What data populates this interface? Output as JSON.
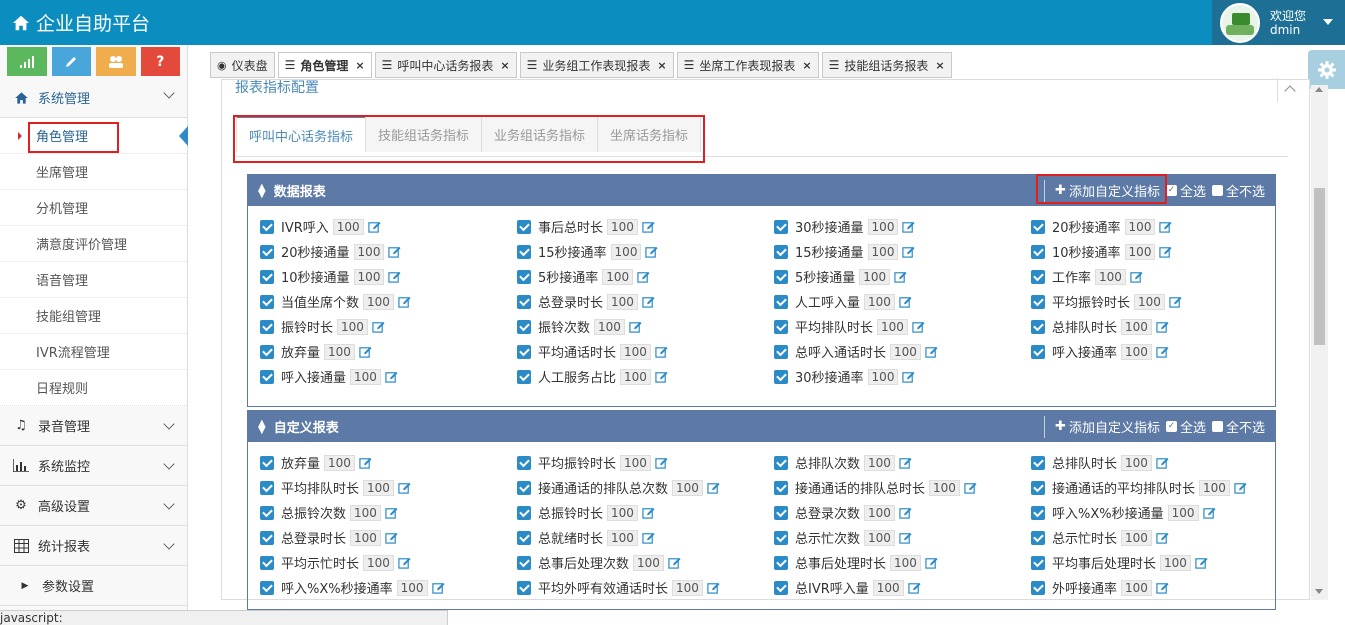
{
  "header": {
    "title": "企业自助平台",
    "welcome": "欢迎您",
    "username": "dmin"
  },
  "sidebar": {
    "groups": [
      {
        "label": "系统管理",
        "icon": "home-icon",
        "open": true,
        "items": [
          "角色管理",
          "坐席管理",
          "分机管理",
          "满意度评价管理",
          "语音管理",
          "技能组管理",
          "IVR流程管理",
          "日程规则"
        ]
      },
      {
        "label": "录音管理",
        "icon": "music-icon"
      },
      {
        "label": "系统监控",
        "icon": "bar-chart-icon"
      },
      {
        "label": "高级设置",
        "icon": "gears-icon"
      },
      {
        "label": "统计报表",
        "icon": "table-icon"
      },
      {
        "label": "参数设置",
        "icon": "caret-right-icon"
      }
    ]
  },
  "tabs": [
    {
      "label": "仪表盘",
      "icon": "dashboard-icon",
      "closable": false
    },
    {
      "label": "角色管理",
      "icon": "list-icon",
      "closable": true,
      "active": true
    },
    {
      "label": "呼叫中心话务报表",
      "icon": "list-icon",
      "closable": true
    },
    {
      "label": "业务组工作表现报表",
      "icon": "list-icon",
      "closable": true
    },
    {
      "label": "坐席工作表现报表",
      "icon": "list-icon",
      "closable": true
    },
    {
      "label": "技能组话务报表",
      "icon": "list-icon",
      "closable": true
    }
  ],
  "panel": {
    "title": "报表指标配置"
  },
  "subtabs": [
    "呼叫中心话务指标",
    "技能组话务指标",
    "业务组话务指标",
    "坐席话务指标"
  ],
  "actions": {
    "add": "添加自定义指标",
    "select_all": "全选",
    "select_none": "全不选"
  },
  "data_report": {
    "title": "数据报表",
    "items": [
      [
        "IVR呼入",
        "100"
      ],
      [
        "事后总时长",
        "100"
      ],
      [
        "30秒接通量",
        "100"
      ],
      [
        "20秒接通率",
        "100"
      ],
      [
        "20秒接通量",
        "100"
      ],
      [
        "15秒接通率",
        "100"
      ],
      [
        "15秒接通量",
        "100"
      ],
      [
        "10秒接通率",
        "100"
      ],
      [
        "10秒接通量",
        "100"
      ],
      [
        "5秒接通率",
        "100"
      ],
      [
        "5秒接通量",
        "100"
      ],
      [
        "工作率",
        "100"
      ],
      [
        "当值坐席个数",
        "100"
      ],
      [
        "总登录时长",
        "100"
      ],
      [
        "人工呼入量",
        "100"
      ],
      [
        "平均振铃时长",
        "100"
      ],
      [
        "振铃时长",
        "100"
      ],
      [
        "振铃次数",
        "100"
      ],
      [
        "平均排队时长",
        "100"
      ],
      [
        "总排队时长",
        "100"
      ],
      [
        "放弃量",
        "100"
      ],
      [
        "平均通话时长",
        "100"
      ],
      [
        "总呼入通话时长",
        "100"
      ],
      [
        "呼入接通率",
        "100"
      ],
      [
        "呼入接通量",
        "100"
      ],
      [
        "人工服务占比",
        "100"
      ],
      [
        "30秒接通率",
        "100"
      ]
    ]
  },
  "custom_report": {
    "title": "自定义报表",
    "items": [
      [
        "放弃量",
        "100"
      ],
      [
        "平均振铃时长",
        "100"
      ],
      [
        "总排队次数",
        "100"
      ],
      [
        "总排队时长",
        "100"
      ],
      [
        "平均排队时长",
        "100"
      ],
      [
        "接通通话的排队总次数",
        "100"
      ],
      [
        "接通通话的排队总时长",
        "100"
      ],
      [
        "接通通话的平均排队时长",
        "100"
      ],
      [
        "总振铃次数",
        "100"
      ],
      [
        "总振铃时长",
        "100"
      ],
      [
        "总登录次数",
        "100"
      ],
      [
        "呼入%X%秒接通量",
        "100"
      ],
      [
        "总登录时长",
        "100"
      ],
      [
        "总就绪时长",
        "100"
      ],
      [
        "总示忙次数",
        "100"
      ],
      [
        "总示忙时长",
        "100"
      ],
      [
        "平均示忙时长",
        "100"
      ],
      [
        "总事后处理次数",
        "100"
      ],
      [
        "总事后处理时长",
        "100"
      ],
      [
        "平均事后处理时长",
        "100"
      ],
      [
        "呼入%X%秒接通率",
        "100"
      ],
      [
        "平均外呼有效通话时长",
        "100"
      ],
      [
        "总IVR呼入量",
        "100"
      ],
      [
        "外呼接通率",
        "100"
      ]
    ]
  },
  "status_bar": "javascript:"
}
